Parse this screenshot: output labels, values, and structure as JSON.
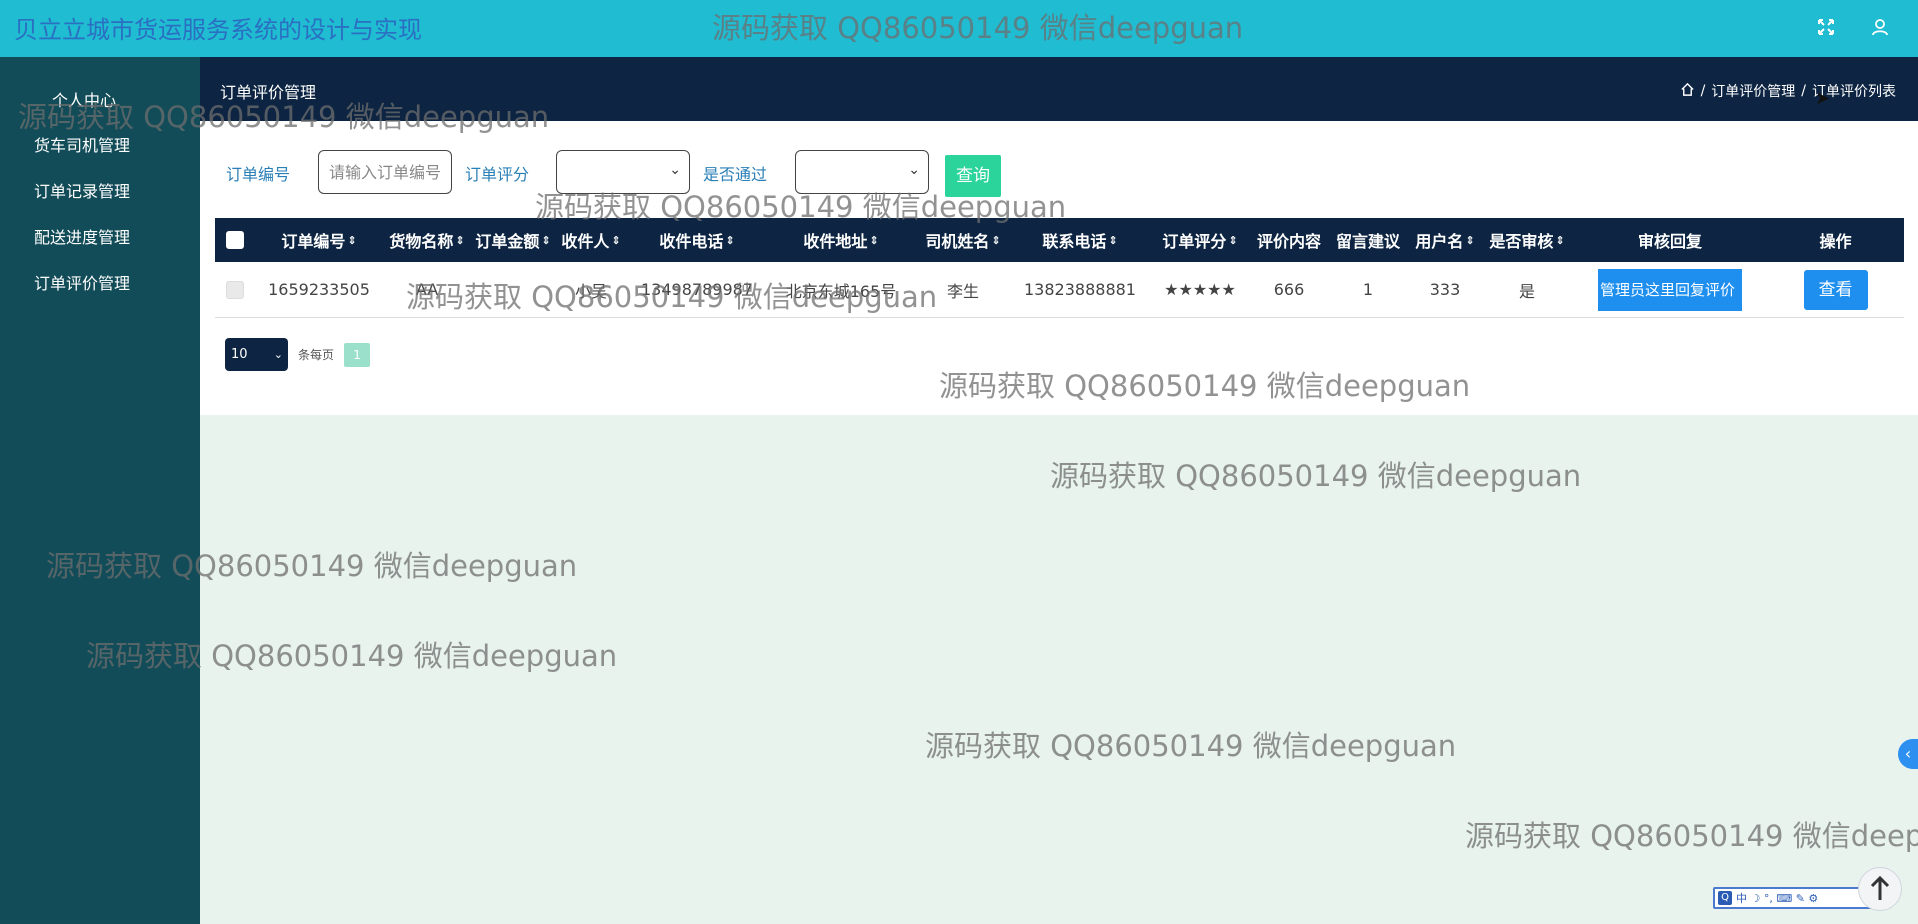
{
  "app": {
    "title": "贝立立城市货运服务系统的设计与实现",
    "top_icons": [
      "fullscreen-icon",
      "user-icon"
    ]
  },
  "sidebar": {
    "items": [
      {
        "label": "个人中心"
      },
      {
        "label": "货车司机管理"
      },
      {
        "label": "订单记录管理"
      },
      {
        "label": "配送进度管理"
      },
      {
        "label": "订单评价管理"
      }
    ]
  },
  "header": {
    "title": "订单评价管理",
    "breadcrumb": {
      "sep": "/",
      "level1": "订单评价管理",
      "level2": "订单评价列表"
    }
  },
  "search": {
    "order_no_label": "订单编号",
    "order_no_placeholder": "请输入订单编号",
    "order_rating_label": "订单评分",
    "approved_label": "是否通过",
    "query_button": "查询"
  },
  "table": {
    "columns": [
      "订单编号",
      "货物名称",
      "订单金额",
      "收件人",
      "收件电话",
      "收件地址",
      "司机姓名",
      "联系电话",
      "订单评分",
      "评价内容",
      "留言建议",
      "用户名",
      "是否审核",
      "审核回复",
      "操作"
    ],
    "rows": [
      {
        "order_no": "1659233505",
        "goods_name": "AA",
        "amount": "",
        "recipient": "小吴",
        "recipient_phone": "13498789987",
        "recipient_address": "北京东城165号",
        "driver_name": "李生",
        "contact_phone": "13823888881",
        "rating": "★★★★★",
        "review_content": "666",
        "suggestion": "1",
        "username": "333",
        "audited": "是",
        "audit_reply": "管理员这里回复评价",
        "action_label": "查看"
      }
    ]
  },
  "pagination": {
    "page_size": "10",
    "per_page_label": "条每页",
    "current_page": "1"
  },
  "watermark_text": "源码获取 QQ86050149 微信deepguan",
  "colors": {
    "topbar": "#1fbcd2",
    "sidebar": "#124c58",
    "header": "#0d2542",
    "accent_green": "#2bd49a",
    "accent_blue": "#1e8fef",
    "content_bg": "#e8f3ee"
  }
}
